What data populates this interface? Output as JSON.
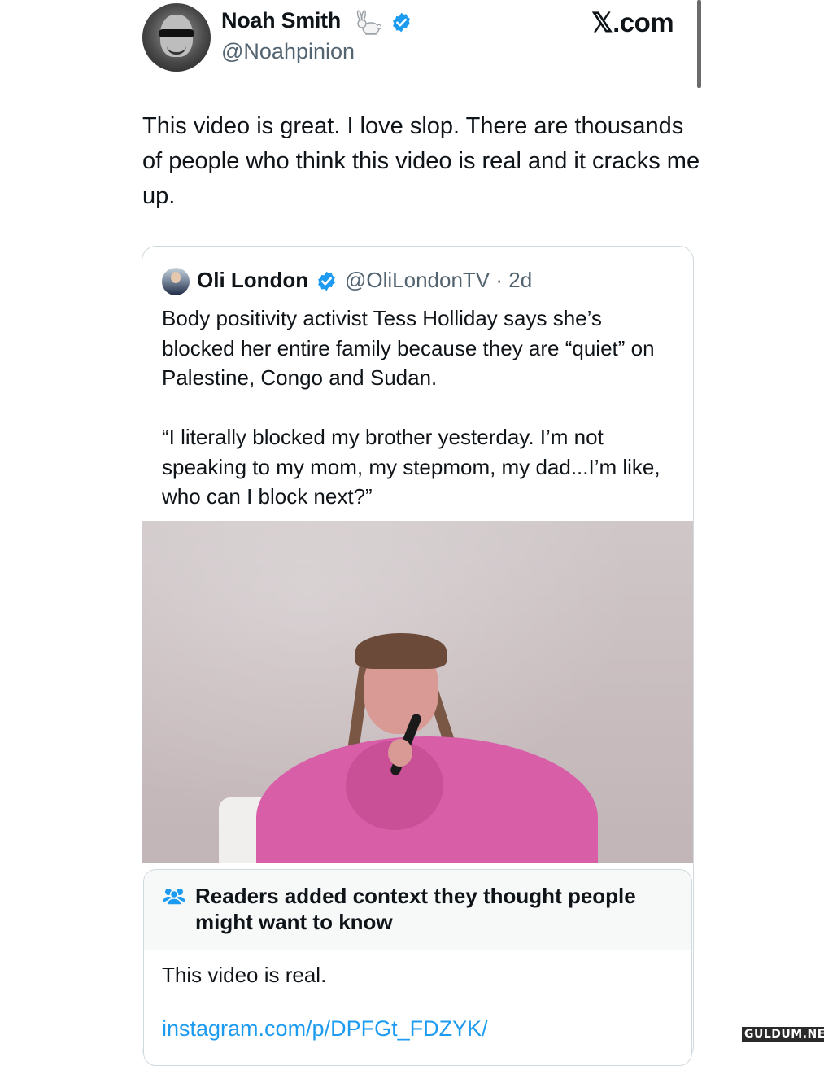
{
  "header": {
    "author_name": "Noah Smith",
    "author_handle": "@Noahpinion",
    "site_label": "𝕏.com",
    "icons": [
      "rabbit-icon",
      "verified-badge-icon"
    ]
  },
  "tweet": {
    "text": "This video is great. I love slop. There are thousands of people who think this video is real and it cracks me up."
  },
  "quoted_tweet": {
    "author_name": "Oli London",
    "handle_and_time": "@OliLondonTV · 2d",
    "text": "Body positivity activist Tess Holliday says she’s blocked her entire family because they are “quiet” on Palestine, Congo and Sudan.\n\n“I literally blocked my brother yesterday. I’m not speaking to my mom, my stepmom, my dad...I’m like, who can I block next?”",
    "media": "video-frame"
  },
  "community_note": {
    "title": "Readers added context they thought people might want to know",
    "text": "This video is real.",
    "link": "instagram.com/p/DPFGt_FDZYK/",
    "icon": "people-icon"
  },
  "watermark": "GULDUM.NET",
  "colors": {
    "text": "#0f1419",
    "secondary": "#536471",
    "link": "#1d9bf0",
    "verified": "#1d9bf0",
    "border": "#cfd9de"
  }
}
